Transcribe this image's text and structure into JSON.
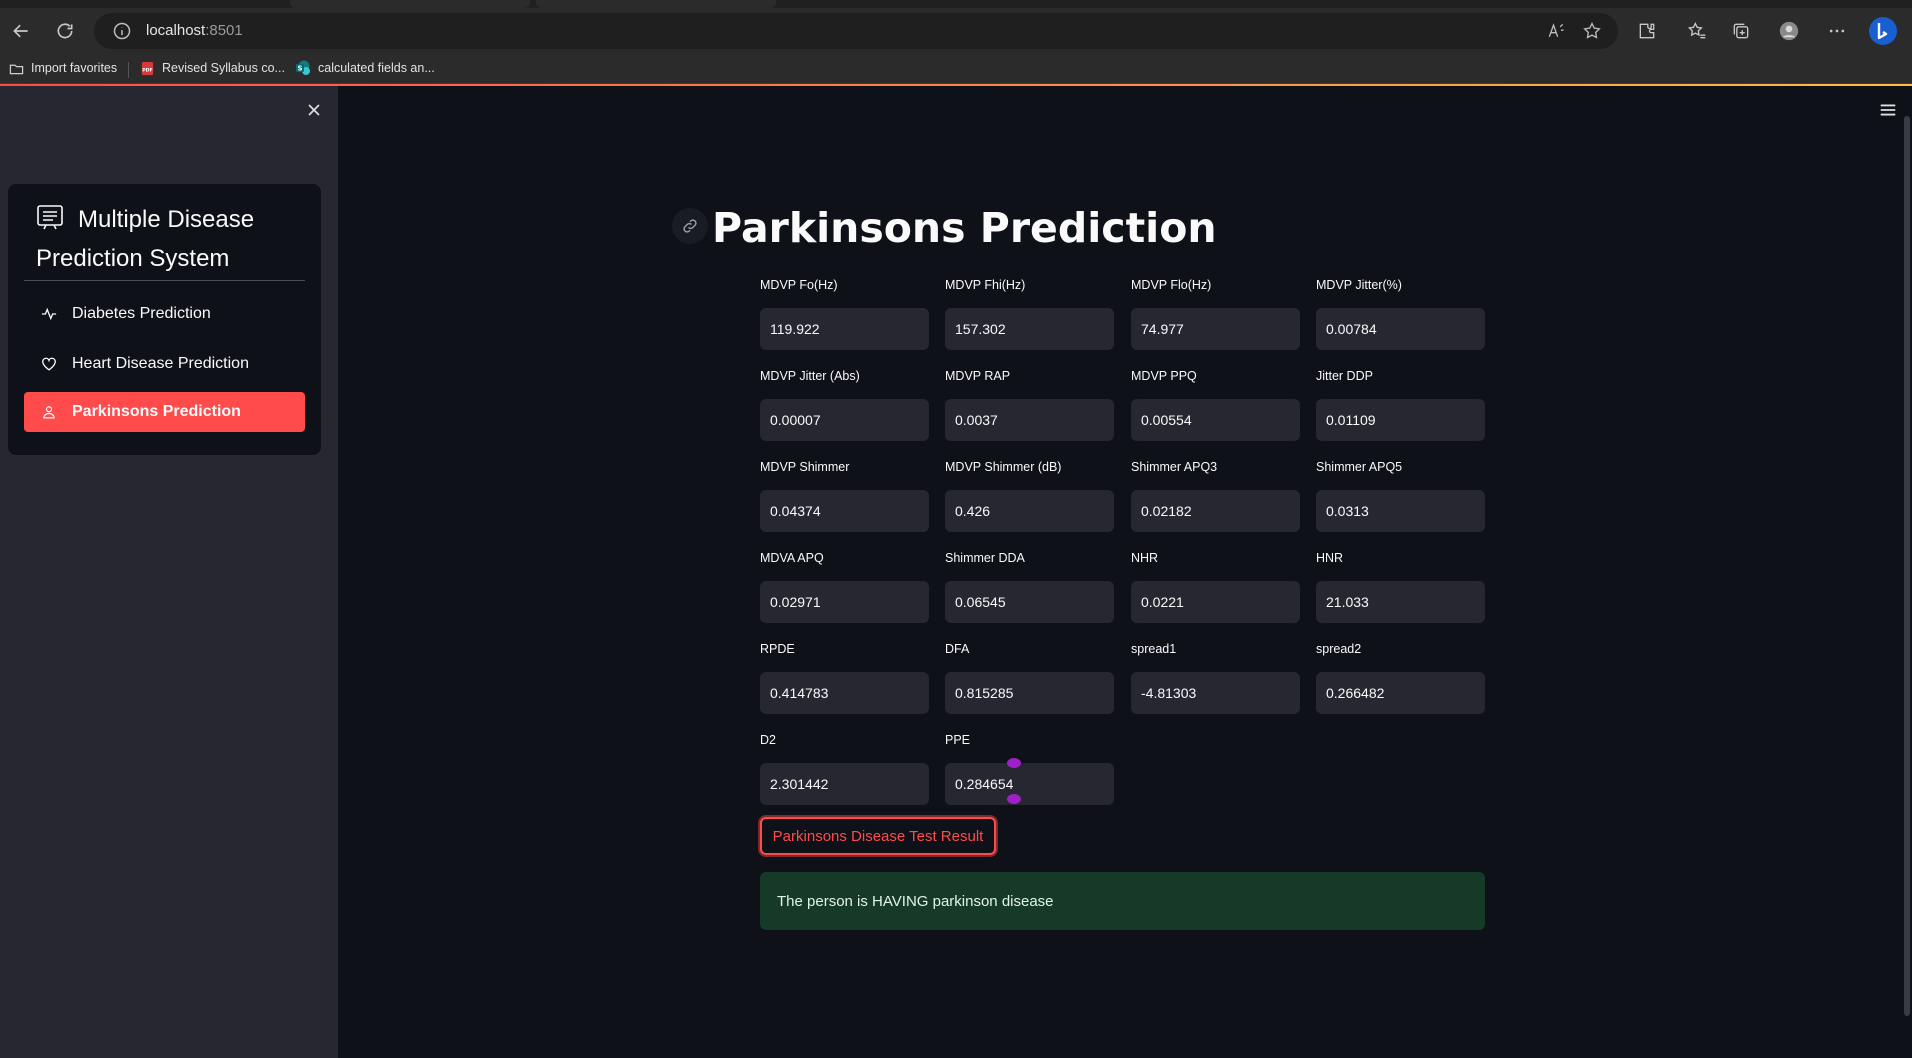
{
  "browser": {
    "url_host": "localhost",
    "url_port": ":8501",
    "bookmarks": [
      {
        "label": "Import favorites",
        "icon": "import-favorites-icon"
      },
      {
        "label": "Revised Syllabus co...",
        "icon": "pdf-icon"
      },
      {
        "label": "calculated fields an...",
        "icon": "sharepoint-icon"
      }
    ]
  },
  "sidebar": {
    "menu_title": "Multiple Disease Prediction System",
    "items": [
      {
        "label": "Diabetes Prediction",
        "icon": "activity-icon",
        "active": false
      },
      {
        "label": "Heart Disease Prediction",
        "icon": "heart-icon",
        "active": false
      },
      {
        "label": "Parkinsons Prediction",
        "icon": "person-icon",
        "active": true
      }
    ]
  },
  "main": {
    "title": "Parkinsons Prediction",
    "fields": [
      {
        "label": "MDVP Fo(Hz)",
        "value": "119.922"
      },
      {
        "label": "MDVP Fhi(Hz)",
        "value": "157.302"
      },
      {
        "label": "MDVP Flo(Hz)",
        "value": "74.977"
      },
      {
        "label": "MDVP Jitter(%)",
        "value": "0.00784"
      },
      {
        "label": "MDVP Jitter (Abs)",
        "value": "0.00007"
      },
      {
        "label": "MDVP RAP",
        "value": "0.0037"
      },
      {
        "label": "MDVP PPQ",
        "value": "0.00554"
      },
      {
        "label": "Jitter DDP",
        "value": "0.01109"
      },
      {
        "label": "MDVP Shimmer",
        "value": "0.04374"
      },
      {
        "label": "MDVP Shimmer (dB)",
        "value": "0.426"
      },
      {
        "label": "Shimmer APQ3",
        "value": "0.02182"
      },
      {
        "label": "Shimmer APQ5",
        "value": "0.0313"
      },
      {
        "label": "MDVA APQ",
        "value": "0.02971"
      },
      {
        "label": "Shimmer DDA",
        "value": "0.06545"
      },
      {
        "label": "NHR",
        "value": "0.0221"
      },
      {
        "label": "HNR",
        "value": "21.033"
      },
      {
        "label": "RPDE",
        "value": "0.414783"
      },
      {
        "label": "DFA",
        "value": "0.815285"
      },
      {
        "label": "spread1",
        "value": "-4.81303"
      },
      {
        "label": "spread2",
        "value": "0.266482"
      },
      {
        "label": "D2",
        "value": "2.301442"
      },
      {
        "label": "PPE",
        "value": "0.284654"
      }
    ],
    "button_label": "Parkinsons Disease Test Result",
    "result_text": "The person is HAVING parkinson disease"
  },
  "colors": {
    "accent": "#ff4b4b",
    "background": "#0e1117",
    "sidebar": "#262730",
    "input": "#262730",
    "success_bg": "#173928"
  }
}
